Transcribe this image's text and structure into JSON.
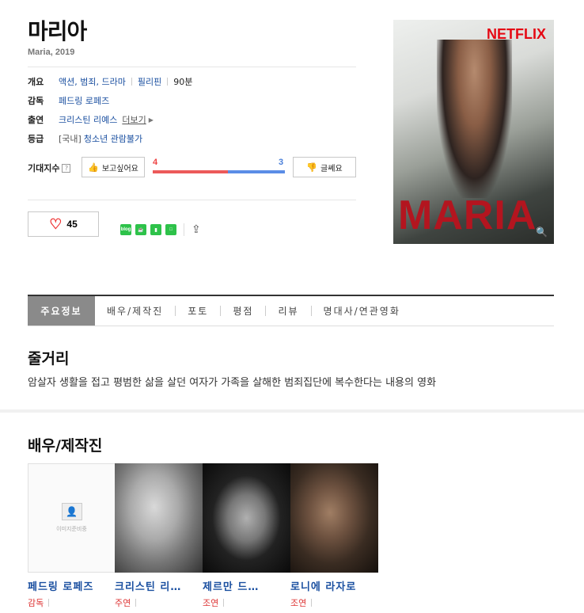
{
  "movie": {
    "title": "마리아",
    "subtitle": "Maria, 2019",
    "info": {
      "overview_label": "개요",
      "genre": "액션, 범죄, 드라마",
      "country": "필리핀",
      "runtime": "90분",
      "director_label": "감독",
      "director": "페드링 로페즈",
      "cast_label": "출연",
      "cast": "크리스틴 리예스",
      "more": "더보기",
      "rating_label": "등급",
      "rating_prefix": "[국내]",
      "rating": "청소년 관람불가"
    },
    "expectation": {
      "label": "기대지수",
      "help": "?",
      "want_label": "보고싶어요",
      "no_label": "글쎄요",
      "want_count": "4",
      "no_count": "3",
      "want_ratio": 0.571
    },
    "likes": "45",
    "share_icons": [
      "blog",
      "cafe",
      "bookmark",
      "note"
    ],
    "poster": {
      "brand": "NETFLIX",
      "title": "MARIA"
    }
  },
  "tabs": [
    {
      "label": "주요정보",
      "active": true
    },
    {
      "label": "배우/제작진",
      "active": false
    },
    {
      "label": "포토",
      "active": false
    },
    {
      "label": "평점",
      "active": false
    },
    {
      "label": "리뷰",
      "active": false
    },
    {
      "label": "명대사/연관영화",
      "active": false
    }
  ],
  "synopsis": {
    "heading": "줄거리",
    "text": "암살자 생활을 접고 평범한 삶을 살던 여자가 가족을 살해한 범죄집단에 복수한다는 내용의 영화"
  },
  "cast_section": {
    "heading": "배우/제작진",
    "placeholder_caption": "이미지준비중",
    "people": [
      {
        "name": "페드링 로페즈",
        "role": "감독"
      },
      {
        "name": "크리스틴 리…",
        "role": "주연"
      },
      {
        "name": "제르만 드…",
        "role": "조연"
      },
      {
        "name": "로니에 라자로",
        "role": "조연"
      }
    ]
  }
}
